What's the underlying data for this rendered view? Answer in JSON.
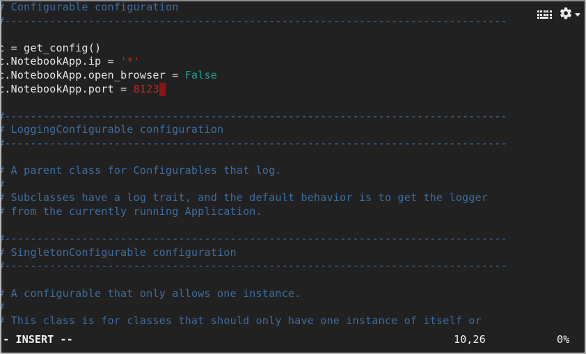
{
  "window": {
    "background": "#212121",
    "border_color": "#b9b9b9"
  },
  "colors": {
    "comment": "#3f6d9e",
    "plain": "#e6e6e6",
    "string": "#c62828",
    "boolean": "#1f9c92",
    "number": "#c62828",
    "cursor": "#8c1414",
    "background": "#212121",
    "status_text": "#f2f2f2"
  },
  "editor": {
    "lines": [
      {
        "segments": [
          {
            "text": "# Configurable configuration",
            "style": "comment"
          }
        ]
      },
      {
        "segments": [
          {
            "text": "#------------------------------------------------------------------------------",
            "style": "comment"
          }
        ]
      },
      {
        "segments": [
          {
            "text": "",
            "style": "comment"
          }
        ]
      },
      {
        "segments": [
          {
            "text": "c = get_config()",
            "style": "plain"
          }
        ]
      },
      {
        "segments": [
          {
            "text": "c.NotebookApp.ip = ",
            "style": "plain"
          },
          {
            "text": "'*'",
            "style": "string"
          }
        ]
      },
      {
        "segments": [
          {
            "text": "c.NotebookApp.open_browser = ",
            "style": "plain"
          },
          {
            "text": "False",
            "style": "bool"
          }
        ]
      },
      {
        "segments": [
          {
            "text": "c.NotebookApp.port = ",
            "style": "plain"
          },
          {
            "text": "8123",
            "style": "num"
          },
          {
            "text": " ",
            "style": "cursor"
          }
        ]
      },
      {
        "segments": [
          {
            "text": "",
            "style": "comment"
          }
        ]
      },
      {
        "segments": [
          {
            "text": "#------------------------------------------------------------------------------",
            "style": "comment"
          }
        ]
      },
      {
        "segments": [
          {
            "text": "# LoggingConfigurable configuration",
            "style": "comment"
          }
        ]
      },
      {
        "segments": [
          {
            "text": "#------------------------------------------------------------------------------",
            "style": "comment"
          }
        ]
      },
      {
        "segments": [
          {
            "text": "",
            "style": "comment"
          }
        ]
      },
      {
        "segments": [
          {
            "text": "# A parent class for Configurables that log.",
            "style": "comment"
          }
        ]
      },
      {
        "segments": [
          {
            "text": "#",
            "style": "comment"
          }
        ]
      },
      {
        "segments": [
          {
            "text": "# Subclasses have a log trait, and the default behavior is to get the logger",
            "style": "comment"
          }
        ]
      },
      {
        "segments": [
          {
            "text": "# from the currently running Application.",
            "style": "comment"
          }
        ]
      },
      {
        "segments": [
          {
            "text": "",
            "style": "comment"
          }
        ]
      },
      {
        "segments": [
          {
            "text": "#------------------------------------------------------------------------------",
            "style": "comment"
          }
        ]
      },
      {
        "segments": [
          {
            "text": "# SingletonConfigurable configuration",
            "style": "comment"
          }
        ]
      },
      {
        "segments": [
          {
            "text": "#------------------------------------------------------------------------------",
            "style": "comment"
          }
        ]
      },
      {
        "segments": [
          {
            "text": "",
            "style": "comment"
          }
        ]
      },
      {
        "segments": [
          {
            "text": "# A configurable that only allows one instance.",
            "style": "comment"
          }
        ]
      },
      {
        "segments": [
          {
            "text": "#",
            "style": "comment"
          }
        ]
      },
      {
        "segments": [
          {
            "text": "# This class is for classes that should only have one instance of itself or",
            "style": "comment"
          }
        ]
      }
    ]
  },
  "statusbar": {
    "mode": "-- INSERT --",
    "position": "10,26",
    "percent": "0%"
  },
  "overlay": {
    "keyboard_icon": "keyboard-icon",
    "settings_icon": "gear-icon",
    "dropdown_icon": "chevron-down-icon"
  }
}
